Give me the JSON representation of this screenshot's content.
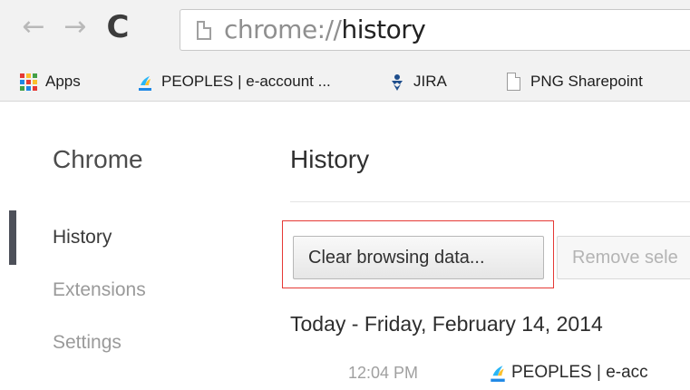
{
  "browser": {
    "back_icon": "arrow-left-icon",
    "forward_icon": "arrow-right-icon",
    "reload_icon": "reload-icon",
    "back_glyph": "←",
    "forward_glyph": "→",
    "reload_glyph": "C",
    "address": {
      "scheme": "chrome://",
      "path": "history",
      "icon": "page-icon"
    }
  },
  "bookmarks": [
    {
      "label": "Apps",
      "icon": "apps-grid-icon"
    },
    {
      "label": "PEOPLES | e-account ...",
      "icon": "peoples-logo-icon"
    },
    {
      "label": "JIRA",
      "icon": "jira-logo-icon"
    },
    {
      "label": "PNG Sharepoint",
      "icon": "page-icon"
    }
  ],
  "sidebar": {
    "title": "Chrome",
    "items": [
      {
        "label": "History",
        "selected": true
      },
      {
        "label": "Extensions",
        "selected": false
      },
      {
        "label": "Settings",
        "selected": false
      }
    ]
  },
  "main": {
    "title": "History",
    "clear_button": "Clear browsing data...",
    "remove_button": "Remove sele",
    "day_header": "Today - Friday, February 14, 2014",
    "entries": [
      {
        "time": "12:04 PM",
        "title": "PEOPLES | e-acc",
        "icon": "peoples-logo-icon"
      }
    ]
  },
  "colors": {
    "highlight_border": "#e53935",
    "apps_grid": [
      "#e53935",
      "#fbc02d",
      "#43a047",
      "#1e88e5",
      "#e53935",
      "#fbc02d",
      "#43a047",
      "#1e88e5",
      "#e53935"
    ]
  }
}
